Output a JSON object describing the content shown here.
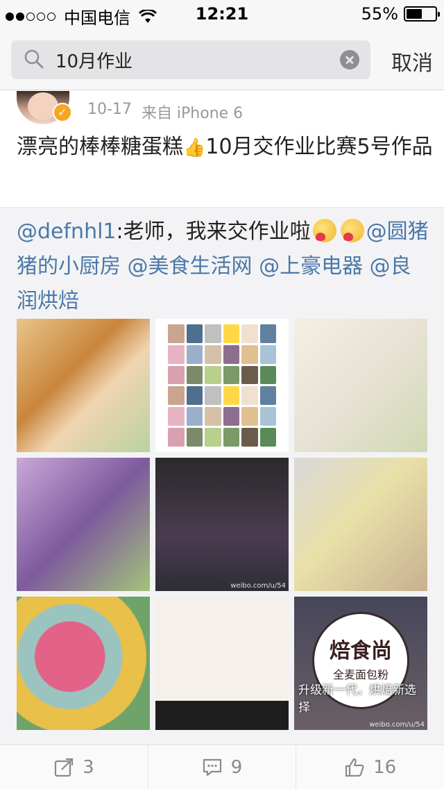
{
  "status_bar": {
    "carrier": "中国电信",
    "time": "12:21",
    "battery": "55%",
    "battery_level": 0.55
  },
  "search": {
    "query": "10月作业",
    "cancel_label": "取消"
  },
  "post": {
    "time": "10-17",
    "source": "来自 iPhone 6",
    "text_before": "漂亮的棒棒糖蛋糕",
    "text_after": "10月交作业比赛5号作品"
  },
  "repost": {
    "author_mention": "@defnhl1",
    "text_1": ":老师，我来交作业啦",
    "mention_1": "@圆猪猪的小厨房",
    "mention_2": "@美食生活网",
    "mention_3": "@上豪电器",
    "mention_4": "@良润烘焙"
  },
  "images": {
    "photo_9_caption": "升级新一代，烘焙新选择",
    "photo_9_logo": "焙食尚",
    "photo_9_logo_sub": "全麦面包粉",
    "photo_5_watermark": "weibo.com/u/54",
    "photo_9_watermark": "weibo.com/u/54"
  },
  "actions": {
    "repost_count": "3",
    "comment_count": "9",
    "like_count": "16"
  }
}
